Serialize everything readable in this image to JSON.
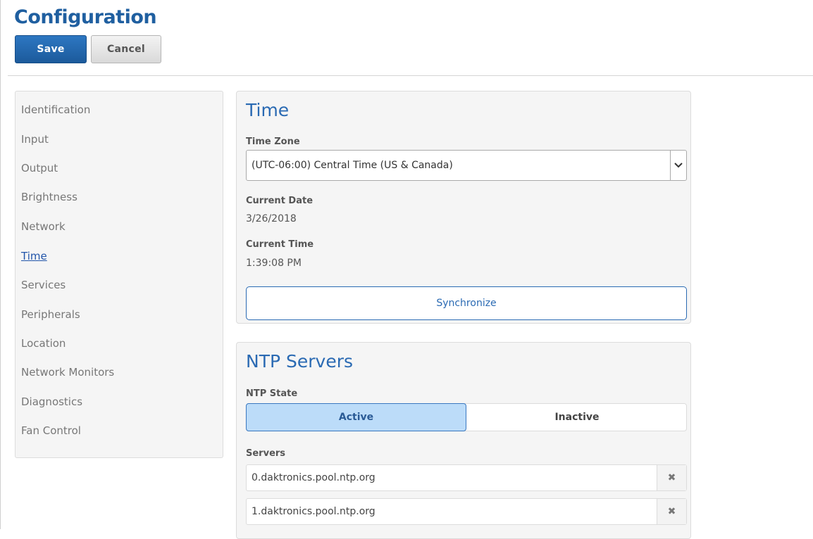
{
  "header": {
    "title": "Configuration",
    "save_label": "Save",
    "cancel_label": "Cancel"
  },
  "sidebar": {
    "items": [
      {
        "label": "Identification"
      },
      {
        "label": "Input"
      },
      {
        "label": "Output"
      },
      {
        "label": "Brightness"
      },
      {
        "label": "Network"
      },
      {
        "label": "Time",
        "active": true
      },
      {
        "label": "Services"
      },
      {
        "label": "Peripherals"
      },
      {
        "label": "Location"
      },
      {
        "label": "Network Monitors"
      },
      {
        "label": "Diagnostics"
      },
      {
        "label": "Fan Control"
      }
    ]
  },
  "time_panel": {
    "title": "Time",
    "timezone_label": "Time Zone",
    "timezone_value": "(UTC-06:00) Central Time (US & Canada)",
    "date_label": "Current Date",
    "date_value": "3/26/2018",
    "time_label": "Current Time",
    "time_value": "1:39:08 PM",
    "sync_label": "Synchronize"
  },
  "ntp_panel": {
    "title": "NTP Servers",
    "state_label": "NTP State",
    "active_label": "Active",
    "inactive_label": "Inactive",
    "selected_state": "Active",
    "servers_label": "Servers",
    "servers": [
      {
        "value": "0.daktronics.pool.ntp.org",
        "remove_icon": "✖"
      },
      {
        "value": "1.daktronics.pool.ntp.org",
        "remove_icon": "✖"
      }
    ]
  },
  "colors": {
    "accent": "#2a6ab3",
    "title_blue": "#1f5fa0",
    "toggle_active_bg": "#bcdcf9"
  }
}
